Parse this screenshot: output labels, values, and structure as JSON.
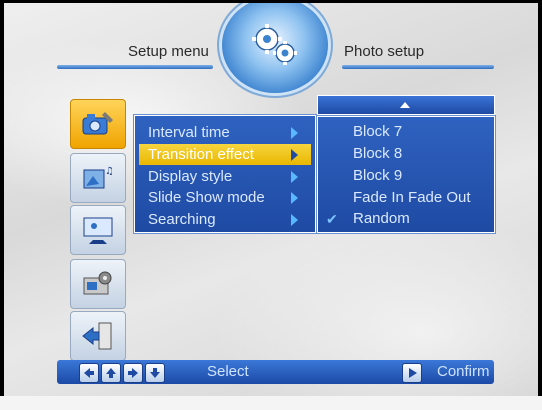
{
  "header": {
    "left_title": "Setup menu",
    "right_title": "Photo setup"
  },
  "sidebar": {
    "items": [
      {
        "icon": "camera-settings-icon",
        "active": true
      },
      {
        "icon": "slideshow-icon",
        "active": false
      },
      {
        "icon": "display-icon",
        "active": false
      },
      {
        "icon": "settings-gear-icon",
        "active": false
      },
      {
        "icon": "exit-door-icon",
        "active": false
      }
    ]
  },
  "menu": {
    "items": [
      {
        "label": "Interval time"
      },
      {
        "label": "Transition effect",
        "selected": true
      },
      {
        "label": "Display style"
      },
      {
        "label": "Slide Show mode"
      },
      {
        "label": "Searching"
      }
    ]
  },
  "options": {
    "items": [
      {
        "label": "Block 7"
      },
      {
        "label": "Block 8"
      },
      {
        "label": "Block 9"
      },
      {
        "label": "Fade In Fade Out"
      },
      {
        "label": "Random",
        "checked": true
      }
    ],
    "check_symbol": "✔"
  },
  "footer": {
    "select_label": "Select",
    "confirm_label": "Confirm"
  },
  "colors": {
    "panel_blue": "#2f62c0",
    "highlight_yellow": "#f7d53e",
    "accent_light_blue": "#5ab8ff"
  }
}
